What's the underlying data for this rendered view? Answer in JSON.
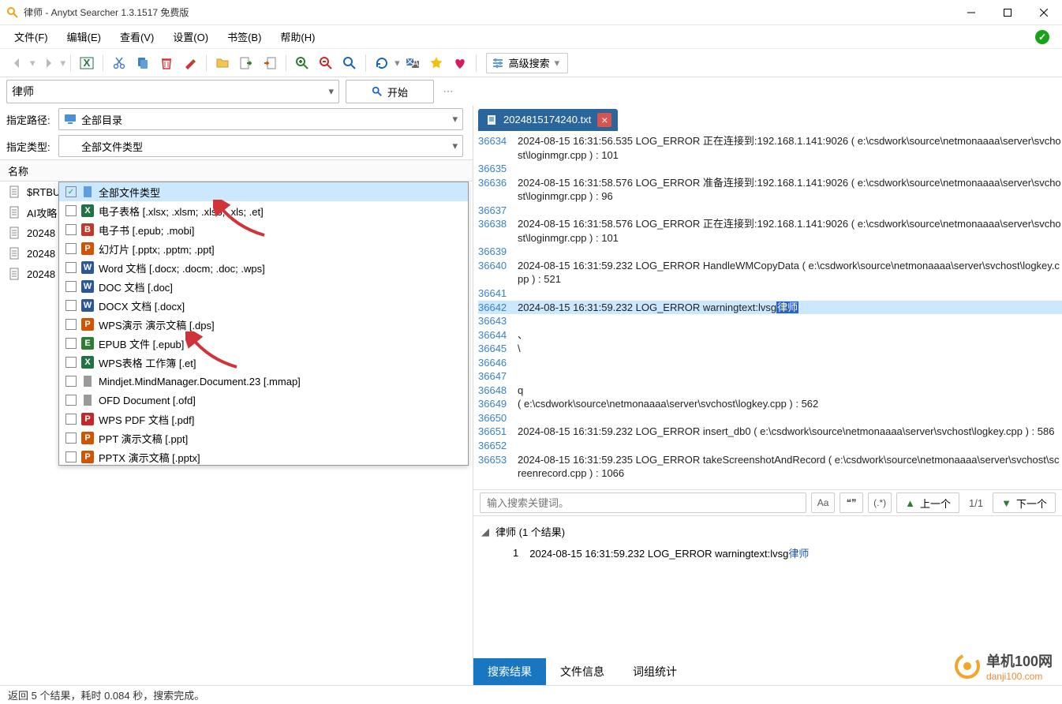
{
  "window": {
    "title": "律师 - Anytxt Searcher 1.3.1517 免费版"
  },
  "menu": {
    "items": [
      "文件(F)",
      "编辑(E)",
      "查看(V)",
      "设置(O)",
      "书签(B)",
      "帮助(H)"
    ]
  },
  "toolbar": {
    "advanced_search": "高级搜索"
  },
  "search": {
    "query": "律师",
    "start_label": "开始"
  },
  "filters": {
    "path_label": "指定路径:",
    "path_value": "全部目录",
    "type_label": "指定类型:",
    "type_value": "全部文件类型"
  },
  "type_options": [
    {
      "label": "全部文件类型",
      "icon": "file",
      "color": "#4a90d9",
      "checked": true,
      "selected": true
    },
    {
      "label": "电子表格 [.xlsx; .xlsm; .xlsb; .xls; .et]",
      "icon": "X",
      "color": "#1f7244",
      "checked": false
    },
    {
      "label": "电子书 [.epub; .mobi]",
      "icon": "B",
      "color": "#c0392b",
      "checked": false
    },
    {
      "label": "幻灯片 [.pptx; .pptm; .ppt]",
      "icon": "P",
      "color": "#d35400",
      "checked": false
    },
    {
      "label": "Word 文档 [.docx; .docm; .doc; .wps]",
      "icon": "W",
      "color": "#2b579a",
      "checked": false
    },
    {
      "label": "DOC 文档 [.doc]",
      "icon": "W",
      "color": "#2b579a",
      "checked": false
    },
    {
      "label": "DOCX 文档 [.docx]",
      "icon": "W",
      "color": "#2b579a",
      "checked": false
    },
    {
      "label": "WPS演示 演示文稿 [.dps]",
      "icon": "P",
      "color": "#d35400",
      "checked": false
    },
    {
      "label": "EPUB 文件 [.epub]",
      "icon": "E",
      "color": "#2e7d32",
      "checked": false
    },
    {
      "label": "WPS表格 工作簿 [.et]",
      "icon": "X",
      "color": "#1f7244",
      "checked": false
    },
    {
      "label": "Mindjet.MindManager.Document.23 [.mmap]",
      "icon": "file",
      "color": "#888888",
      "checked": false
    },
    {
      "label": "OFD Document [.ofd]",
      "icon": "file",
      "color": "#888888",
      "checked": false
    },
    {
      "label": "WPS PDF 文档 [.pdf]",
      "icon": "P",
      "color": "#c62828",
      "checked": false
    },
    {
      "label": "PPT 演示文稿 [.ppt]",
      "icon": "P",
      "color": "#d35400",
      "checked": false
    },
    {
      "label": "PPTX 演示文稿 [.pptx]",
      "icon": "P",
      "color": "#d35400",
      "checked": false
    }
  ],
  "results": {
    "header_name": "名称",
    "rows": [
      "$RTBU",
      "AI攻略",
      "20248",
      "20248",
      "20248"
    ]
  },
  "preview": {
    "tab_filename": "2024815174240.txt",
    "lines": [
      {
        "n": "36634",
        "t": "2024-08-15 16:31:56.535 LOG_ERROR 正在连接到:192.168.1.141:9026 ( e:\\csdwork\\source\\netmonaaaa\\server\\svchost\\loginmgr.cpp ) : 101"
      },
      {
        "n": "36635",
        "t": ""
      },
      {
        "n": "36636",
        "t": "2024-08-15 16:31:58.576 LOG_ERROR 准备连接到:192.168.1.141:9026 ( e:\\csdwork\\source\\netmonaaaa\\server\\svchost\\loginmgr.cpp ) : 96"
      },
      {
        "n": "36637",
        "t": ""
      },
      {
        "n": "36638",
        "t": "2024-08-15 16:31:58.576 LOG_ERROR 正在连接到:192.168.1.141:9026 ( e:\\csdwork\\source\\netmonaaaa\\server\\svchost\\loginmgr.cpp ) : 101"
      },
      {
        "n": "36639",
        "t": ""
      },
      {
        "n": "36640",
        "t": "2024-08-15 16:31:59.232 LOG_ERROR HandleWMCopyData ( e:\\csdwork\\source\\netmonaaaa\\server\\svchost\\logkey.cpp ) : 521"
      },
      {
        "n": "36641",
        "t": ""
      },
      {
        "n": "36642",
        "t": "2024-08-15 16:31:59.232 LOG_ERROR warningtext:lvsg",
        "hl": true,
        "mark": "律师"
      },
      {
        "n": "36643",
        "t": ""
      },
      {
        "n": "36644",
        "t": "、"
      },
      {
        "n": "36645",
        "t": "\\"
      },
      {
        "n": "36646",
        "t": ""
      },
      {
        "n": "36647",
        "t": ""
      },
      {
        "n": "36648",
        "t": "q"
      },
      {
        "n": "36649",
        "t": "( e:\\csdwork\\source\\netmonaaaa\\server\\svchost\\logkey.cpp ) : 562"
      },
      {
        "n": "36650",
        "t": ""
      },
      {
        "n": "36651",
        "t": "2024-08-15 16:31:59.232 LOG_ERROR insert_db0 ( e:\\csdwork\\source\\netmonaaaa\\server\\svchost\\logkey.cpp ) : 586"
      },
      {
        "n": "36652",
        "t": ""
      },
      {
        "n": "36653",
        "t": "2024-08-15 16:31:59.235 LOG_ERROR takeScreenshotAndRecord ( e:\\csdwork\\source\\netmonaaaa\\server\\svchost\\screenrecord.cpp ) : 1066"
      }
    ]
  },
  "find": {
    "placeholder": "输入搜索关键词。",
    "aa": "Aa",
    "quote": "❝❞",
    "regex": "(.*)",
    "prev": "上一个",
    "next": "下一个",
    "count": "1/1"
  },
  "matches": {
    "header": "律师 (1 个结果)",
    "items": [
      {
        "num": "1",
        "text": "2024-08-15 16:31:59.232 LOG_ERROR warningtext:lvsg",
        "keyword": "律师"
      }
    ]
  },
  "bottom_tabs": [
    "搜索结果",
    "文件信息",
    "词组统计"
  ],
  "watermark": {
    "brand": "单机100网",
    "url": "danji100.com"
  },
  "status": {
    "text": "返回 5 个结果，耗时 0.084 秒，搜索完成。"
  }
}
